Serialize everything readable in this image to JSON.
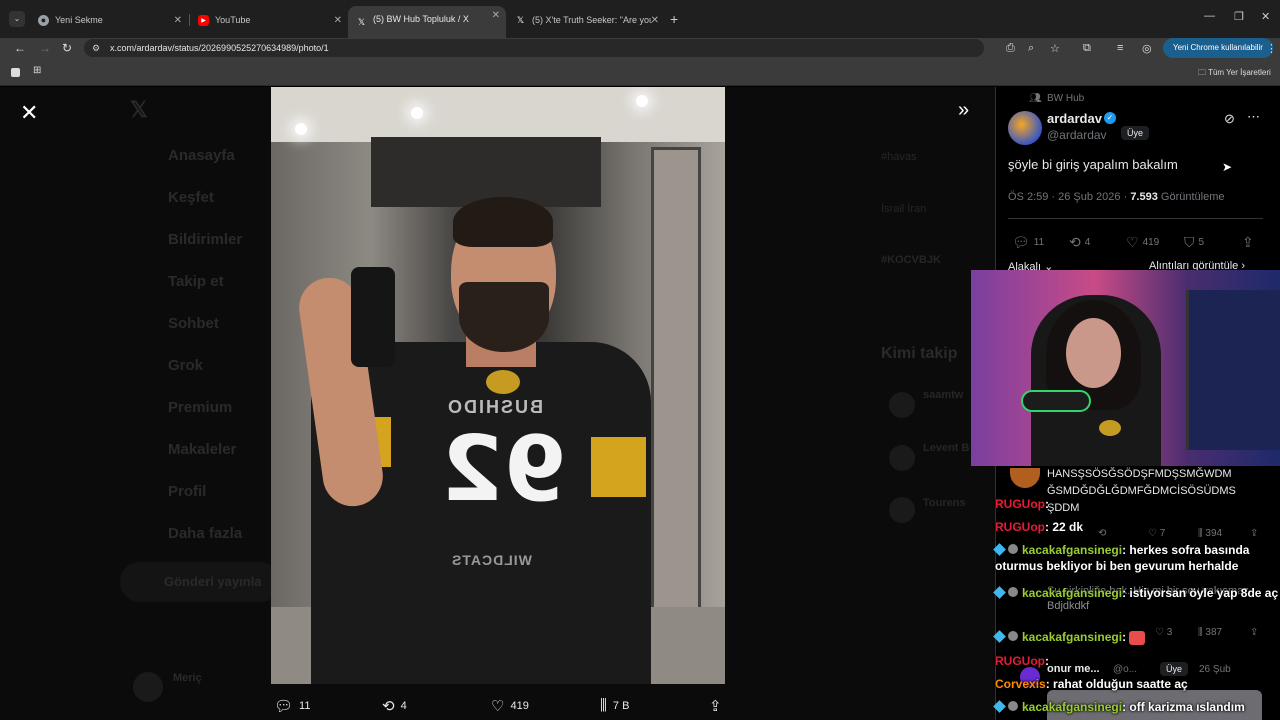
{
  "browser": {
    "tabs": [
      {
        "title": "Yeni Sekme",
        "icon": "chrome-icon"
      },
      {
        "title": "YouTube",
        "icon": "youtube-icon"
      },
      {
        "title": "(5) BW Hub Topluluk / X",
        "icon": "x-icon"
      },
      {
        "title": "(5) X'te Truth Seeker: \"Are you",
        "icon": "x-icon"
      }
    ],
    "url": "x.com/ardardav/status/2026990525270634989/photo/1",
    "update_button": "Yeni Chrome kullanılabilir",
    "bookmarks_folder": "Tüm Yer İşaretleri"
  },
  "background_nav": {
    "items": [
      "Anasayfa",
      "Keşfet",
      "Bildirimler",
      "Takip et",
      "Sohbet",
      "Grok",
      "Premium",
      "Makaleler",
      "Profil",
      "Daha fazla"
    ],
    "post_button": "Gönderi yayınla",
    "trend_1": "#havas",
    "trend_2": "İsrail İran",
    "trend_3": "#KOCVBJK",
    "follow_title": "Kimi takip",
    "follow_1": "saamtw",
    "follow_2": "Levent B",
    "follow_3": "Tourens",
    "account": "Meriç"
  },
  "photo": {
    "jersey_number": "92",
    "jersey_brand": "BUSHIDO",
    "jersey_bottom": "WILDCATS"
  },
  "photo_actions": {
    "replies": "11",
    "reposts": "4",
    "likes": "419",
    "views": "7 B"
  },
  "tweet": {
    "community": "BW Hub",
    "display_name": "ardardav",
    "handle": "@ardardav",
    "role_badge": "Üye",
    "text": "şöyle bi giriş yapalım bakalım",
    "time": "ÖS 2:59 · 26 Şub 2026 · ",
    "views": "7.593",
    "views_label": " Görüntüleme",
    "replies": "11",
    "reposts": "4",
    "likes": "419",
    "bookmarks": "5",
    "sort_label": "Alakalı",
    "quotes_label": "Alıntıları görüntüle"
  },
  "reply": {
    "text": "HANSŞSÖSĞSÖDŞFMDŞSMĞWDM ĞSMDĞDĞLĞDMFĞDMCİSÖSÜDMS ŞDDM",
    "stats_views": "394",
    "stats_likes": "7",
    "faint_text": "Şu sirkinliğe bak. Hiç mi bir şey yakışmaz. Bdjdkdkf",
    "stats2_likes": "3",
    "stats2_views": "387",
    "reply2_name": "onur me...",
    "reply2_handle": "@o...",
    "reply2_badge": "Üye",
    "reply2_date": "26 Şub"
  },
  "chat": [
    {
      "user": "RUGUop",
      "text": ": ",
      "color": "red"
    },
    {
      "user": "RUGUop",
      "text": ": 22 dk",
      "color": "red"
    },
    {
      "user": "kacakafgansinegi",
      "text": ": herkes sofra basında oturmus bekliyor bi ben gevurum herhalde",
      "color": "green"
    },
    {
      "user": "kacakafgansinegi",
      "text": ": istiyorsan öyle yap 8de aç",
      "color": "green"
    },
    {
      "user": "kacakafgansinegi",
      "text": ": ",
      "color": "green"
    },
    {
      "user": "RUGUop",
      "text": ": ",
      "color": "red"
    },
    {
      "user": "Corvexis",
      "text": ": rahat olduğun saatte aç",
      "color": "orange"
    },
    {
      "user": "kacakafgansinegi",
      "text": ": off karizma ıslandım",
      "color": "green"
    }
  ]
}
